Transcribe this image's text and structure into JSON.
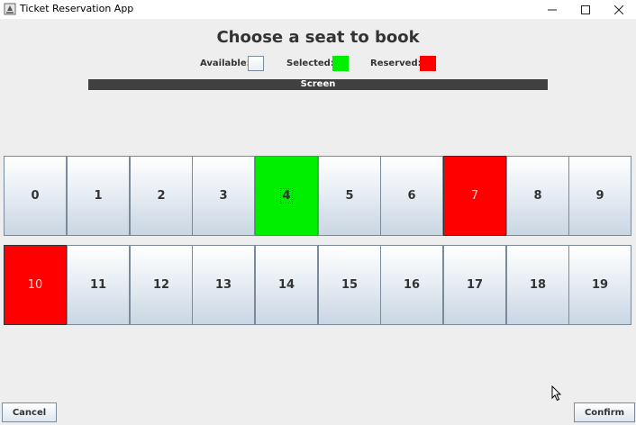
{
  "window": {
    "title": "Ticket Reservation App",
    "controls": {
      "minimize": "—",
      "maximize": "☐",
      "close": "✕"
    },
    "icon": "app-icon"
  },
  "heading": "Choose a seat to book",
  "legend": {
    "available_label": "Available:",
    "selected_label": "Selected:",
    "reserved_label": "Reserved:",
    "available_color": "#e8eef4",
    "selected_color": "#00ee00",
    "reserved_color": "#ff0000"
  },
  "screen_label": "Screen",
  "seats": [
    {
      "label": "0",
      "state": "available"
    },
    {
      "label": "1",
      "state": "available"
    },
    {
      "label": "2",
      "state": "available"
    },
    {
      "label": "3",
      "state": "available"
    },
    {
      "label": "4",
      "state": "selected"
    },
    {
      "label": "5",
      "state": "available"
    },
    {
      "label": "6",
      "state": "available"
    },
    {
      "label": "7",
      "state": "reserved"
    },
    {
      "label": "8",
      "state": "available"
    },
    {
      "label": "9",
      "state": "available"
    },
    {
      "label": "10",
      "state": "reserved"
    },
    {
      "label": "11",
      "state": "available"
    },
    {
      "label": "12",
      "state": "available"
    },
    {
      "label": "13",
      "state": "available"
    },
    {
      "label": "14",
      "state": "available"
    },
    {
      "label": "15",
      "state": "available"
    },
    {
      "label": "16",
      "state": "available"
    },
    {
      "label": "17",
      "state": "available"
    },
    {
      "label": "18",
      "state": "available"
    },
    {
      "label": "19",
      "state": "available"
    }
  ],
  "buttons": {
    "cancel": "Cancel",
    "confirm": "Confirm"
  }
}
